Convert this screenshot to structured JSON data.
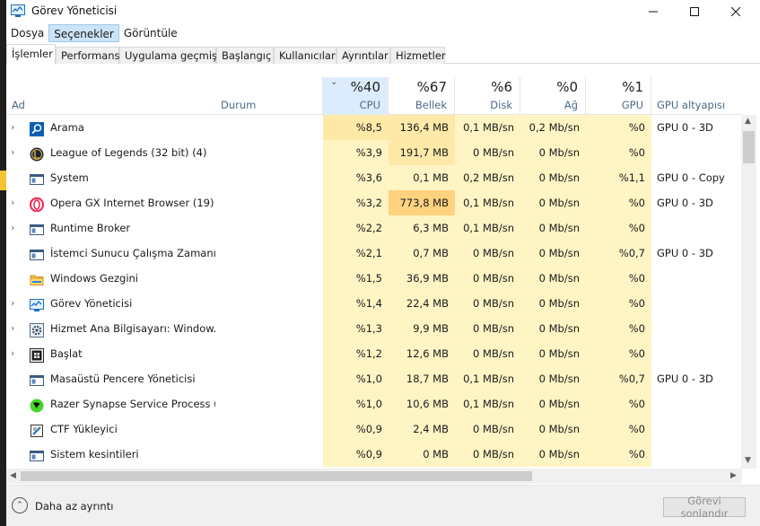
{
  "window": {
    "title": "Görev Yöneticisi"
  },
  "menu": [
    "Dosya",
    "Seçenekler",
    "Görüntüle"
  ],
  "tabs": [
    "İşlemler",
    "Performans",
    "Uygulama geçmişi",
    "Başlangıç",
    "Kullanıcılar",
    "Ayrıntılar",
    "Hizmetler"
  ],
  "columns": {
    "name": "Ad",
    "status": "Durum",
    "cpu": {
      "pct": "%40",
      "label": "CPU"
    },
    "memory": {
      "pct": "%67",
      "label": "Bellek"
    },
    "disk": {
      "pct": "%6",
      "label": "Disk"
    },
    "network": {
      "pct": "%0",
      "label": "Ağ"
    },
    "gpu": {
      "pct": "%1",
      "label": "GPU"
    },
    "gpu_engine": "GPU altyapısı"
  },
  "processes": [
    {
      "name": "Arama",
      "icon": "search-icon",
      "expandable": true,
      "cpu": "%8,5",
      "memory": "136,4 MB",
      "disk": "0,1 MB/sn",
      "network": "0,2 Mb/sn",
      "gpu": "%0",
      "gpu_engine": "GPU 0 - 3D"
    },
    {
      "name": "League of Legends (32 bit) (4)",
      "icon": "league-icon",
      "expandable": true,
      "cpu": "%3,9",
      "memory": "191,7 MB",
      "disk": "0 MB/sn",
      "network": "0 Mb/sn",
      "gpu": "%0",
      "gpu_engine": ""
    },
    {
      "name": "System",
      "icon": "window-icon",
      "expandable": false,
      "cpu": "%3,6",
      "memory": "0,1 MB",
      "disk": "0,2 MB/sn",
      "network": "0 Mb/sn",
      "gpu": "%1,1",
      "gpu_engine": "GPU 0 - Copy"
    },
    {
      "name": "Opera GX Internet Browser (19)",
      "icon": "opera-icon",
      "expandable": true,
      "cpu": "%3,2",
      "memory": "773,8 MB",
      "disk": "0,1 MB/sn",
      "network": "0 Mb/sn",
      "gpu": "%0",
      "gpu_engine": "GPU 0 - 3D"
    },
    {
      "name": "Runtime Broker",
      "icon": "window-icon",
      "expandable": true,
      "cpu": "%2,2",
      "memory": "6,3 MB",
      "disk": "0,1 MB/sn",
      "network": "0 Mb/sn",
      "gpu": "%0",
      "gpu_engine": ""
    },
    {
      "name": "İstemci Sunucu Çalışma Zamanı...",
      "icon": "window-icon",
      "expandable": false,
      "cpu": "%2,1",
      "memory": "0,7 MB",
      "disk": "0 MB/sn",
      "network": "0 Mb/sn",
      "gpu": "%0,7",
      "gpu_engine": "GPU 0 - 3D"
    },
    {
      "name": "Windows Gezgini",
      "icon": "folder-icon",
      "expandable": false,
      "cpu": "%1,5",
      "memory": "36,9 MB",
      "disk": "0 MB/sn",
      "network": "0 Mb/sn",
      "gpu": "%0",
      "gpu_engine": ""
    },
    {
      "name": "Görev Yöneticisi",
      "icon": "task-manager-icon",
      "expandable": true,
      "cpu": "%1,4",
      "memory": "22,4 MB",
      "disk": "0 MB/sn",
      "network": "0 Mb/sn",
      "gpu": "%0",
      "gpu_engine": ""
    },
    {
      "name": "Hizmet Ana Bilgisayarı: Window...",
      "icon": "gear-icon",
      "expandable": true,
      "cpu": "%1,3",
      "memory": "9,9 MB",
      "disk": "0 MB/sn",
      "network": "0 Mb/sn",
      "gpu": "%0",
      "gpu_engine": ""
    },
    {
      "name": "Başlat",
      "icon": "start-icon",
      "expandable": true,
      "cpu": "%1,2",
      "memory": "12,6 MB",
      "disk": "0 MB/sn",
      "network": "0 Mb/sn",
      "gpu": "%0",
      "gpu_engine": ""
    },
    {
      "name": "Masaüstü Pencere Yöneticisi",
      "icon": "window-icon",
      "expandable": false,
      "cpu": "%1,0",
      "memory": "18,7 MB",
      "disk": "0,1 MB/sn",
      "network": "0 Mb/sn",
      "gpu": "%0,7",
      "gpu_engine": "GPU 0 - 3D"
    },
    {
      "name": "Razer Synapse Service Process (...",
      "icon": "razer-icon",
      "expandable": false,
      "cpu": "%1,0",
      "memory": "10,6 MB",
      "disk": "0,1 MB/sn",
      "network": "0 Mb/sn",
      "gpu": "%0",
      "gpu_engine": ""
    },
    {
      "name": "CTF Yükleyici",
      "icon": "ctf-icon",
      "expandable": false,
      "cpu": "%0,9",
      "memory": "2,4 MB",
      "disk": "0 MB/sn",
      "network": "0 Mb/sn",
      "gpu": "%0",
      "gpu_engine": ""
    },
    {
      "name": "Sistem kesintileri",
      "icon": "window-icon",
      "expandable": false,
      "cpu": "%0,9",
      "memory": "0 MB",
      "disk": "0 MB/sn",
      "network": "0 Mb/sn",
      "gpu": "%0",
      "gpu_engine": ""
    }
  ],
  "footer": {
    "less_details": "Daha az ayrıntı",
    "end_task": "Görevi sonlandır"
  },
  "colors": {
    "heat_low": "#fff4c4",
    "heat_mid": "#ffe9a8",
    "heat_high": "#ffd27f",
    "sorted_header": "#dcecfc"
  }
}
